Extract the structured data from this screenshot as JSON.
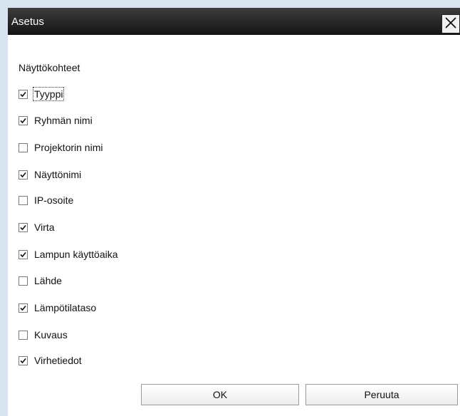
{
  "dialog": {
    "title": "Asetus",
    "section_label": "Näyttökohteet",
    "items": [
      {
        "label": "Tyyppi",
        "checked": true
      },
      {
        "label": "Ryhmän nimi",
        "checked": true
      },
      {
        "label": "Projektorin nimi",
        "checked": false
      },
      {
        "label": "Näyttönimi",
        "checked": true
      },
      {
        "label": "IP-osoite",
        "checked": false
      },
      {
        "label": "Virta",
        "checked": true
      },
      {
        "label": "Lampun käyttöaika",
        "checked": true
      },
      {
        "label": "Lähde",
        "checked": false
      },
      {
        "label": "Lämpötilataso",
        "checked": true
      },
      {
        "label": "Kuvaus",
        "checked": false
      },
      {
        "label": "Virhetiedot",
        "checked": true
      }
    ],
    "ok_label": "OK",
    "cancel_label": "Peruuta",
    "close_icon": "close-icon"
  }
}
